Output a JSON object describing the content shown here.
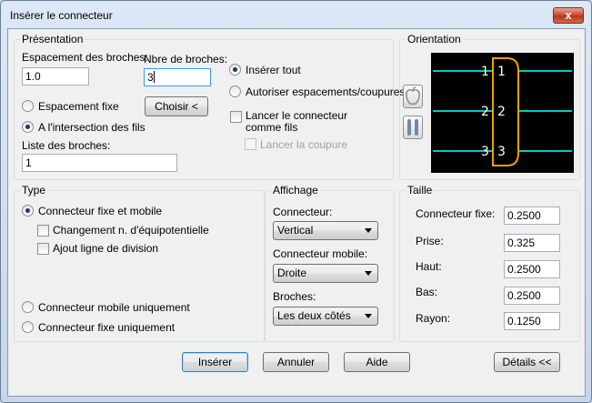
{
  "window": {
    "title": "Insérer le connecteur",
    "close_glyph": "x"
  },
  "presentation": {
    "legend": "Présentation",
    "spacing_label": "Espacement des broches:",
    "spacing_value": "1.0",
    "count_label": "Nbre de broches:",
    "count_value": "3",
    "fixed_spacing_label": "Espacement fixe",
    "choose_button": "Choisir <",
    "at_wire_intersection_label": "A l'intersection des fils",
    "pin_list_label": "Liste des broches:",
    "pin_list_value": "1",
    "insert_all_label": "Insérer tout",
    "allow_gaps_label": "Autoriser espacements/coupures",
    "launch_as_wires_label_1": "Lancer le connecteur",
    "launch_as_wires_label_2": "comme fils",
    "launch_cut_label": "Lancer la coupure"
  },
  "orientation": {
    "legend": "Orientation",
    "pins": [
      {
        "left": "1",
        "right": "1"
      },
      {
        "left": "2",
        "right": "2"
      },
      {
        "left": "3",
        "right": "3"
      }
    ],
    "colors": {
      "background": "#000000",
      "wire": "#00c8c8",
      "body": "#f0a000",
      "label": "#ffffff"
    }
  },
  "type": {
    "legend": "Type",
    "fixed_and_mobile_label": "Connecteur fixe et mobile",
    "equipotential_change_label": "Changement n. d'équipotentielle",
    "add_division_line_label": "Ajout ligne de division",
    "mobile_only_label": "Connecteur mobile uniquement",
    "fixed_only_label": "Connecteur fixe uniquement"
  },
  "display": {
    "legend": "Affichage",
    "connector_label": "Connecteur:",
    "connector_value": "Vertical",
    "mobile_connector_label": "Connecteur mobile:",
    "mobile_connector_value": "Droite",
    "pins_label": "Broches:",
    "pins_value": "Les deux côtés"
  },
  "size": {
    "legend": "Taille",
    "rows": [
      {
        "label": "Connecteur fixe:",
        "value": "0.2500"
      },
      {
        "label": "Prise:",
        "value": "0.325"
      },
      {
        "label": "Haut:",
        "value": "0.2500"
      },
      {
        "label": "Bas:",
        "value": "0.2500"
      },
      {
        "label": "Rayon:",
        "value": "0.1250"
      }
    ]
  },
  "footer": {
    "insert_button": "Insérer",
    "cancel_button": "Annuler",
    "help_button": "Aide",
    "details_button": "Détails <<"
  }
}
